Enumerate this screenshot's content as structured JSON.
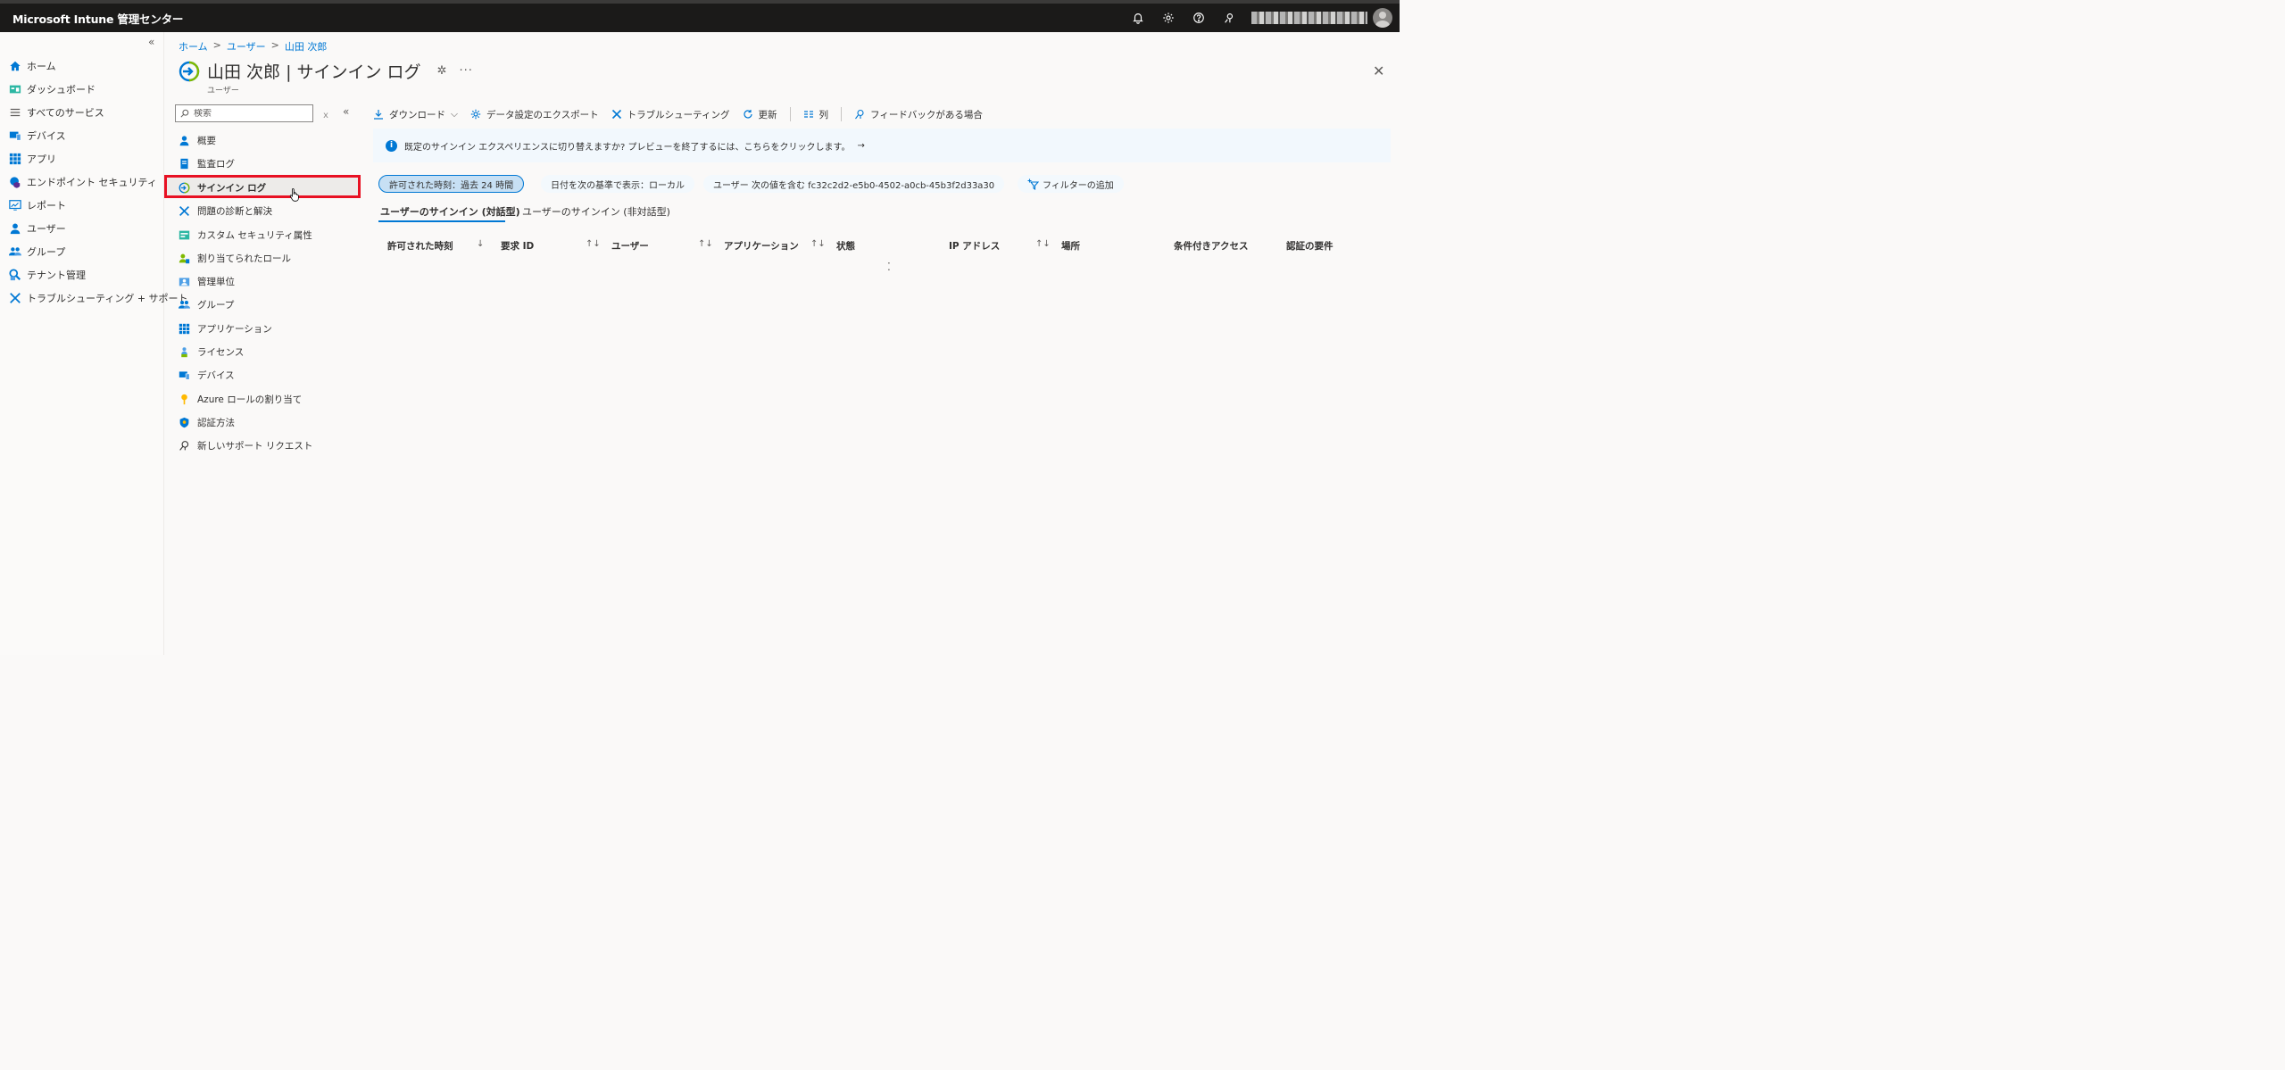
{
  "top_bar": {
    "brand": "Microsoft Intune 管理センター",
    "icons": [
      "bell-icon",
      "gear-icon",
      "help-icon",
      "feedback-icon"
    ],
    "account_label": "redacted account"
  },
  "left_nav": {
    "collapse_label": "«",
    "items": [
      {
        "label": "ホーム",
        "icon": "home-icon"
      },
      {
        "label": "ダッシュボード",
        "icon": "dashboard-icon"
      },
      {
        "label": "すべてのサービス",
        "icon": "list-icon"
      },
      {
        "label": "デバイス",
        "icon": "device-icon"
      },
      {
        "label": "アプリ",
        "icon": "apps-icon"
      },
      {
        "label": "エンドポイント セキュリティ",
        "icon": "endpoint-security-icon"
      },
      {
        "label": "レポート",
        "icon": "report-icon"
      },
      {
        "label": "ユーザー",
        "icon": "user-icon"
      },
      {
        "label": "グループ",
        "icon": "group-icon"
      },
      {
        "label": "テナント管理",
        "icon": "tenant-icon"
      },
      {
        "label": "トラブルシューティング + サポート",
        "icon": "troubleshoot-icon"
      }
    ]
  },
  "breadcrumb": [
    "ホーム",
    "ユーザー",
    "山田 次郎"
  ],
  "page": {
    "title": "山田 次郎 | サインイン ログ",
    "subtitle": "ユーザー",
    "pin_glyph": "✲",
    "more_glyph": "···",
    "close_glyph": "✕"
  },
  "resource_menu": {
    "search_placeholder": "検索",
    "clear_glyph": "ｘ",
    "collapse_glyph": "«",
    "items": [
      {
        "label": "概要",
        "icon": "user-icon"
      },
      {
        "label": "監査ログ",
        "icon": "audit-log-icon"
      },
      {
        "label": "サインイン ログ",
        "icon": "signin-icon",
        "selected": true
      },
      {
        "label": "問題の診断と解決",
        "icon": "diagnose-icon"
      },
      {
        "label": "カスタム セキュリティ属性",
        "icon": "custom-attr-icon"
      },
      {
        "label": "割り当てられたロール",
        "icon": "roles-icon"
      },
      {
        "label": "管理単位",
        "icon": "admin-unit-icon"
      },
      {
        "label": "グループ",
        "icon": "group-icon"
      },
      {
        "label": "アプリケーション",
        "icon": "apps-icon"
      },
      {
        "label": "ライセンス",
        "icon": "license-icon"
      },
      {
        "label": "デバイス",
        "icon": "device-icon"
      },
      {
        "label": "Azure ロールの割り当て",
        "icon": "azure-role-icon"
      },
      {
        "label": "認証方法",
        "icon": "auth-method-icon"
      },
      {
        "label": "新しいサポート リクエスト",
        "icon": "support-icon"
      }
    ]
  },
  "toolbar": {
    "download": "ダウンロード",
    "export_settings": "データ設定のエクスポート",
    "troubleshoot": "トラブルシューティング",
    "refresh": "更新",
    "columns": "列",
    "feedback": "フィードバックがある場合"
  },
  "info_banner": {
    "text": "既定のサインイン エクスペリエンスに切り替えますか? プレビューを終了するには、こちらをクリックします。",
    "arrow": "→"
  },
  "filters": {
    "time": "許可された時刻：過去 24 時間",
    "date_display": "日付を次の基準で表示：ローカル",
    "user_contains": "ユーザー 次の値を含む fc32c2d2-e5b0-4502-a0cb-45b3f2d33a30",
    "add_filter": "フィルターの追加"
  },
  "tabs": {
    "interactive": "ユーザーのサインイン (対話型)",
    "non_interactive": "ユーザーのサインイン (非対話型)"
  },
  "table": {
    "columns": [
      "許可された時刻",
      "要求 ID",
      "ユーザー",
      "アプリケーション",
      "状態",
      "IP アドレス",
      "場所",
      "条件付きアクセス",
      "認証の要件"
    ],
    "sort_glyph": "↑↓",
    "sort_desc_glyph": "↓",
    "loading_glyph": "⁚"
  }
}
